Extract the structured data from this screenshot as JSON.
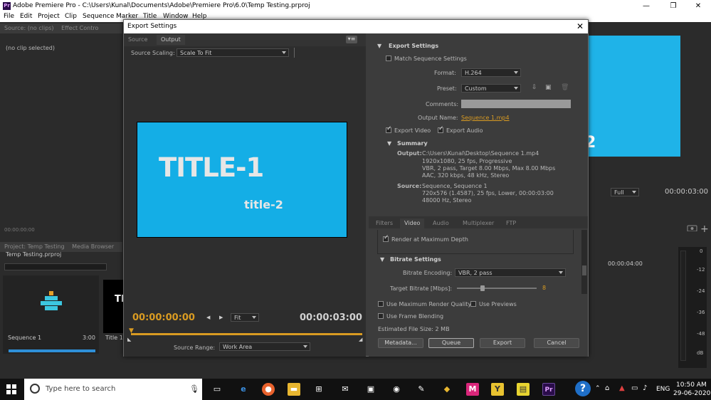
{
  "window": {
    "title": "Adobe Premiere Pro - C:\\Users\\Kunal\\Documents\\Adobe\\Premiere Pro\\6.0\\Temp Testing.prproj",
    "app_icon": "Pr",
    "min": "—",
    "max": "❐",
    "close": "✕"
  },
  "menu": [
    "File",
    "Edit",
    "Project",
    "Clip",
    "Sequence",
    "Marker",
    "Title",
    "Window",
    "Help"
  ],
  "bg": {
    "source_tab": "Source: (no clips)",
    "effect_tab": "Effect Contro",
    "no_clip": "(no clip selected)",
    "timecode_small": "00:00:00:00",
    "project_tab": "Project: Temp Testing",
    "media_tab": "Media Browser",
    "project_file": "Temp Testing.prproj",
    "seq_name": "Sequence 1",
    "seq_dur": "3:00",
    "title_clip": "Title 1",
    "title_thumb_text": "TI",
    "prog_full": "Full",
    "prog_tc": "00:00:03:00",
    "prog_text": "2",
    "tl_tc": "00:00:04:00",
    "meter_labels": [
      "0",
      "-12",
      "-24",
      "-36",
      "-48",
      "dB"
    ]
  },
  "dialog": {
    "title": "Export Settings",
    "close": "✕",
    "tabs": [
      "Source",
      "Output"
    ],
    "source_scaling_label": "Source Scaling:",
    "source_scaling": "Scale To Fit",
    "preview_title1": "TITLE-1",
    "preview_title2": "title-2",
    "timecode_in": "00:00:00:00",
    "timecode_out": "00:00:03:00",
    "fit": "Fit",
    "source_range_label": "Source Range:",
    "source_range": "Work Area",
    "export_settings": "Export Settings",
    "match_sequence": "Match Sequence Settings",
    "format_label": "Format:",
    "format": "H.264",
    "preset_label": "Preset:",
    "preset": "Custom",
    "comments_label": "Comments:",
    "output_name_label": "Output Name:",
    "output_name": "Sequence 1.mp4",
    "export_video": "Export Video",
    "export_audio": "Export Audio",
    "summary": "Summary",
    "output_label": "Output:",
    "output_lines": [
      "C:\\Users\\Kunal\\Desktop\\Sequence 1.mp4",
      "1920x1080, 25 fps, Progressive",
      "VBR, 2 pass, Target 8.00 Mbps, Max 8.00 Mbps",
      "AAC, 320 kbps, 48 kHz, Stereo"
    ],
    "source_label": "Source:",
    "source_lines": [
      "Sequence, Sequence 1",
      "720x576 (1.4587), 25 fps, Lower, 00:00:03:00",
      "48000 Hz, Stereo"
    ],
    "sub_tabs": [
      "Filters",
      "Video",
      "Audio",
      "Multiplexer",
      "FTP"
    ],
    "render_max_depth": "Render at Maximum Depth",
    "bitrate_settings": "Bitrate Settings",
    "bitrate_encoding_label": "Bitrate Encoding:",
    "bitrate_encoding": "VBR, 2 pass",
    "target_bitrate_label": "Target Bitrate [Mbps]:",
    "target_bitrate": "8",
    "use_max_render": "Use Maximum Render Quality",
    "use_previews": "Use Previews",
    "use_frame_blending": "Use Frame Blending",
    "est_size": "Estimated File Size:  2 MB",
    "buttons": {
      "metadata": "Metadata...",
      "queue": "Queue",
      "export": "Export",
      "cancel": "Cancel"
    }
  },
  "taskbar": {
    "search": "Type here to search",
    "lang": "ENG",
    "time": "10:50 AM",
    "date": "29-06-2020"
  }
}
